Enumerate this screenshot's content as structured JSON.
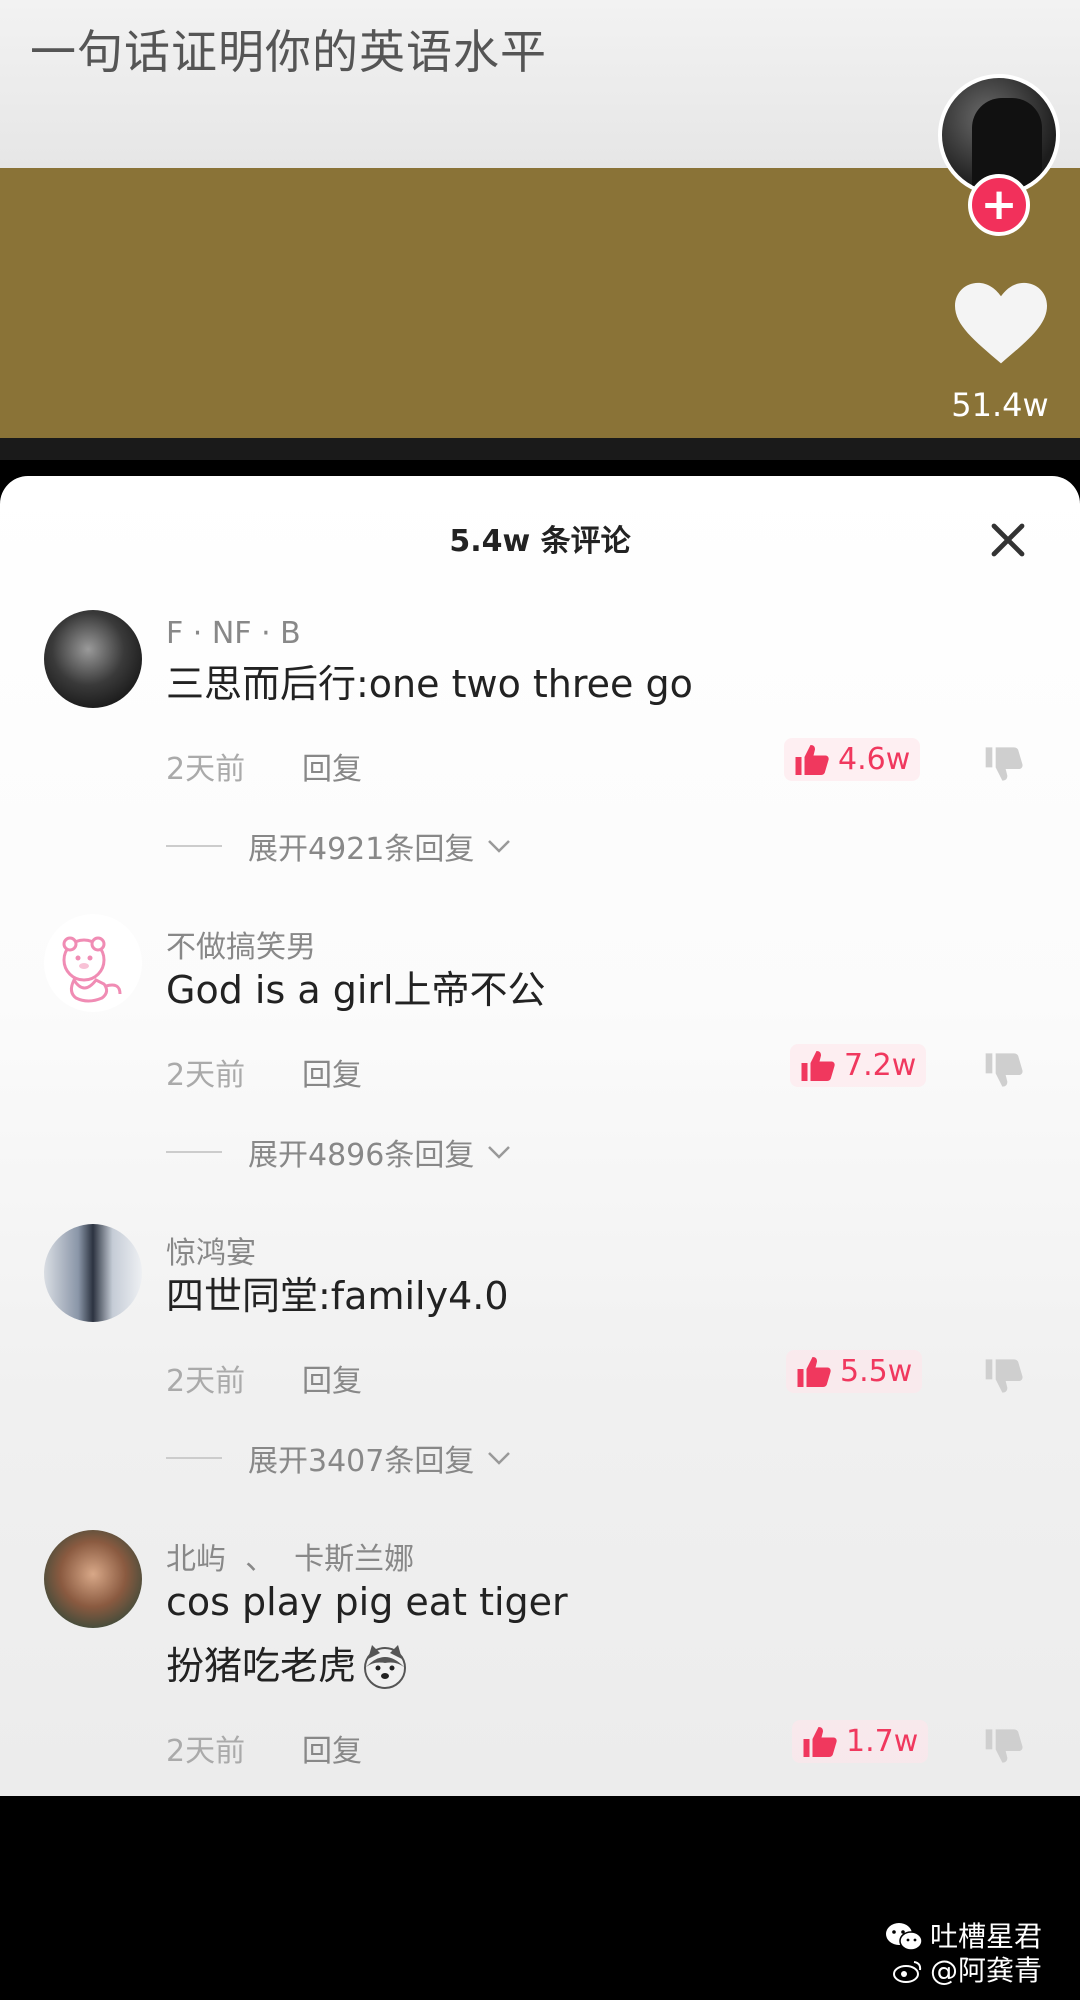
{
  "video": {
    "title": "一句话证明你的英语水平",
    "like_count": "51.4w",
    "follow_symbol": "+"
  },
  "comments_sheet": {
    "header": "5.4w 条评论",
    "comments": [
      {
        "user": "F · NF · B",
        "text": "三思而后行:one two three go",
        "time": "2天前",
        "reply": "回复",
        "likes": "4.6w",
        "expand": "展开4921条回复"
      },
      {
        "user": "不做搞笑男",
        "text": "God is a girl上帝不公",
        "time": "2天前",
        "reply": "回复",
        "likes": "7.2w",
        "expand": "展开4896条回复"
      },
      {
        "user": "惊鸿宴",
        "text": "四世同堂:family4.0",
        "time": "2天前",
        "reply": "回复",
        "likes": "5.5w",
        "expand": "展开3407条回复"
      },
      {
        "user": "北屿  、  卡斯兰娜",
        "text_line1": "cos play pig eat tiger",
        "text_line2": "扮猪吃老虎",
        "time": "2天前",
        "reply": "回复",
        "likes": "1.7w"
      }
    ]
  },
  "watermark": {
    "line1": "吐槽星君",
    "line2": "@阿龚青"
  },
  "colors": {
    "video_band": "#8a7337",
    "like_red": "#f0385e",
    "follow_red": "#f2305b"
  }
}
